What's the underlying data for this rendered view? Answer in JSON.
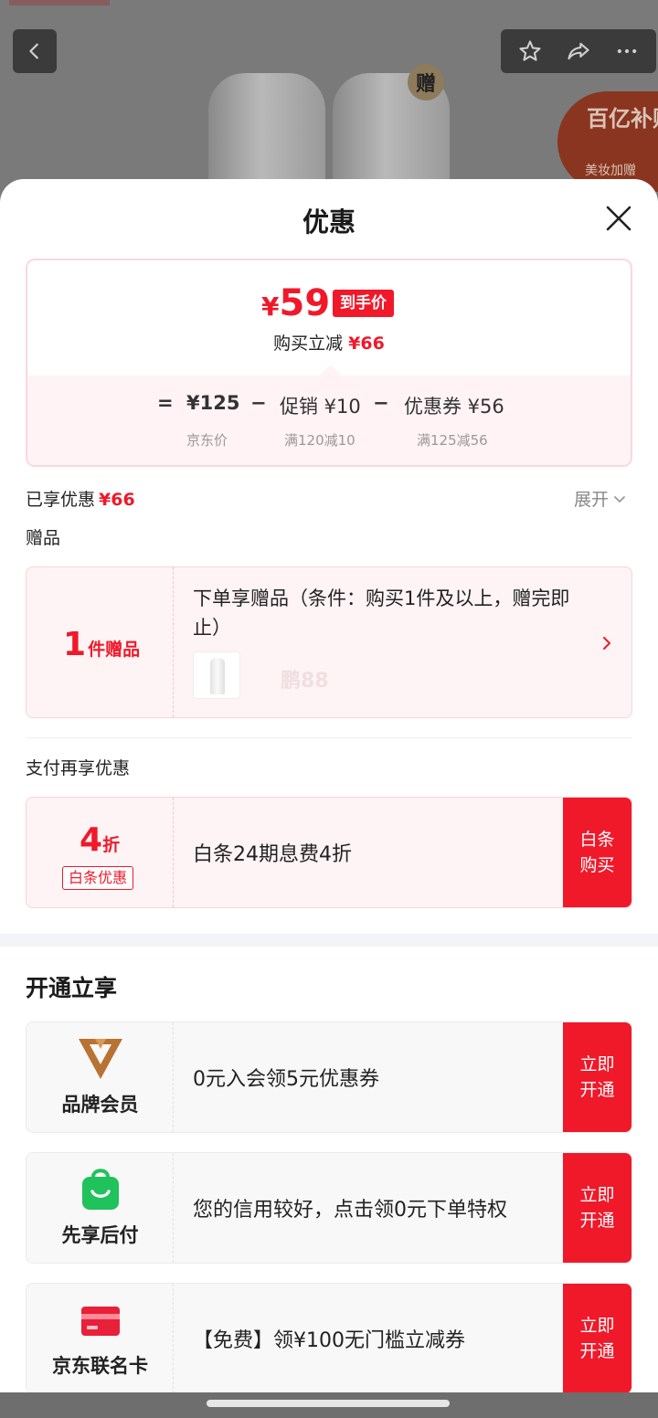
{
  "background": {
    "gift_badge": "赠",
    "subsidy_badge": {
      "line1": "百亿补贴",
      "line2": "美妆加赠"
    }
  },
  "sheet": {
    "title": "优惠",
    "price": {
      "yen": "¥",
      "final_price": "59",
      "final_tag": "到手价",
      "saving_label": "购买立减",
      "saving_value": "¥66",
      "formula": {
        "equals": "=",
        "base_price": "¥125",
        "base_label": "京东价",
        "minus": "−",
        "promo": "促销 ¥10",
        "promo_rule": "满120减10",
        "coupon": "优惠券 ¥56",
        "coupon_rule": "满125减56"
      }
    },
    "enjoyed_label": "已享优惠",
    "enjoyed_value": "¥66",
    "expand_label": "展开",
    "gift_section_label": "赠品",
    "gift": {
      "count": "1",
      "count_unit": "件赠品",
      "description": "下单享赠品（条件：购买1件及以上，赠完即止）",
      "watermark": "鹏88"
    },
    "pay_section_label": "支付再享优惠",
    "baitiao": {
      "discount": "4",
      "discount_unit": "折",
      "tag": "白条优惠",
      "text": "白条24期息费4折",
      "cta": "白条购买"
    },
    "open_section_title": "开通立享",
    "offers": [
      {
        "name": "品牌会员",
        "icon": "brand-v-icon",
        "text": "0元入会领5元优惠券",
        "cta": "立即开通"
      },
      {
        "name": "先享后付",
        "icon": "shopping-bag-icon",
        "text": "您的信用较好，点击领0元下单特权",
        "cta": "立即开通"
      },
      {
        "name": "京东联名卡",
        "icon": "credit-card-icon",
        "text": "【免费】领¥100无门槛立减券",
        "cta": "立即开通"
      }
    ]
  },
  "colors": {
    "accent_red": "#f0192a",
    "pink_bg": "#fff4f5",
    "brand_gold": "#b87333",
    "paylater_green": "#1fc25b",
    "card_red": "#e8203a"
  }
}
